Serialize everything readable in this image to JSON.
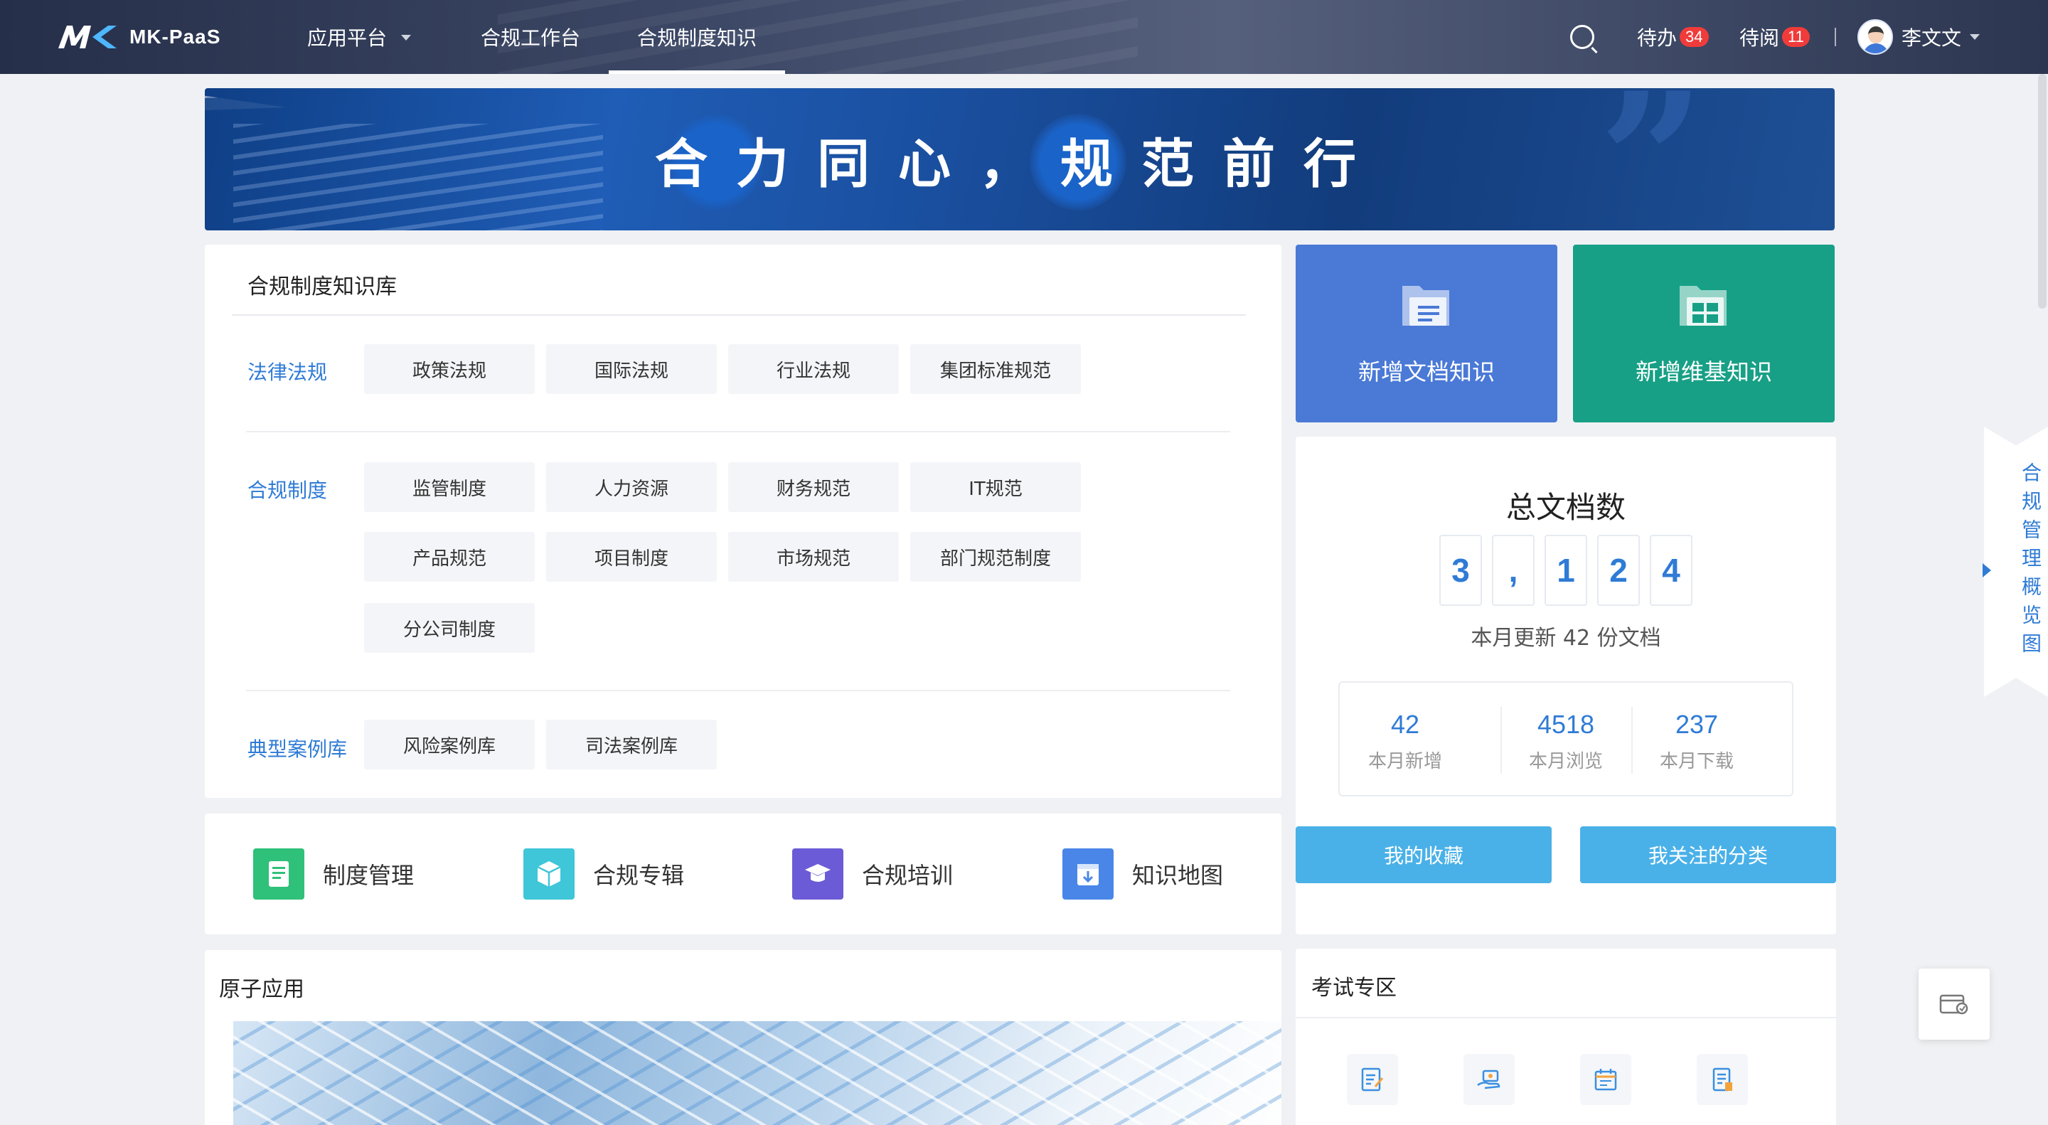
{
  "nav": {
    "logo_text": "MK-PaaS",
    "items": [
      {
        "label": "应用平台",
        "dropdown": true
      },
      {
        "label": "合规工作台",
        "dropdown": false
      },
      {
        "label": "合规制度知识",
        "dropdown": false,
        "active": true
      }
    ],
    "todo_label": "待办",
    "todo_count": "34",
    "toread_label": "待阅",
    "toread_count": "11",
    "user_name": "李文文"
  },
  "banner": {
    "slogan": "合力同心，规范前行"
  },
  "knowledge_base": {
    "title": "合规制度知识库",
    "categories": [
      {
        "label": "法律法规",
        "tags": [
          "政策法规",
          "国际法规",
          "行业法规",
          "集团标准规范"
        ]
      },
      {
        "label": "合规制度",
        "tags": [
          "监管制度",
          "人力资源",
          "财务规范",
          "IT规范",
          "产品规范",
          "项目制度",
          "市场规范",
          "部门规范制度",
          "分公司制度"
        ]
      },
      {
        "label": "典型案例库",
        "tags": [
          "风险案例库",
          "司法案例库"
        ]
      }
    ]
  },
  "quick_links": [
    {
      "label": "制度管理",
      "icon": "document-edit-icon",
      "color": "#2fc07a"
    },
    {
      "label": "合规专辑",
      "icon": "cube-icon",
      "color": "#3fc6d8"
    },
    {
      "label": "合规培训",
      "icon": "graduation-cap-icon",
      "color": "#6b5bd6"
    },
    {
      "label": "知识地图",
      "icon": "download-box-icon",
      "color": "#4a86e8"
    }
  ],
  "atom_apps": {
    "title": "原子应用"
  },
  "actions": {
    "new_doc_label": "新增文档知识",
    "new_doc_color": "#4a79d6",
    "new_wiki_label": "新增维基知识",
    "new_wiki_color": "#17a086"
  },
  "stats": {
    "title": "总文档数",
    "digits": [
      "3",
      ",",
      "1",
      "2",
      "4"
    ],
    "month_update": "本月更新 42 份文档",
    "mini": [
      {
        "value": "42",
        "label": "本月新增"
      },
      {
        "value": "4518",
        "label": "本月浏览"
      },
      {
        "value": "237",
        "label": "本月下载"
      }
    ],
    "favorites_label": "我的收藏",
    "followed_label": "我关注的分类"
  },
  "exam": {
    "title": "考试专区",
    "icons": [
      "exam-edit-icon",
      "exam-hand-icon",
      "exam-calendar-icon",
      "exam-report-icon"
    ]
  },
  "side_tab": {
    "label": "合规管理概览图"
  },
  "colors": {
    "accent": "#2f7bd6",
    "pill": "#4ab1e8"
  }
}
